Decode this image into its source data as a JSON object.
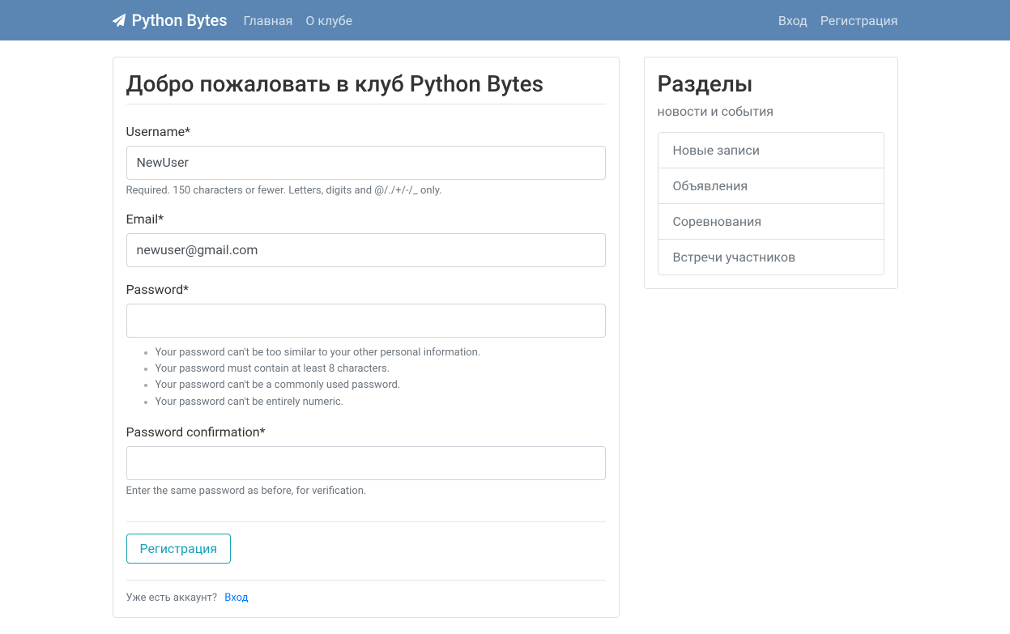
{
  "navbar": {
    "brand": "Python Bytes",
    "left_links": [
      "Главная",
      "О клубе"
    ],
    "right_links": [
      "Вход",
      "Регистрация"
    ]
  },
  "main": {
    "heading": "Добро пожаловать в клуб Python Bytes",
    "form": {
      "username": {
        "label": "Username*",
        "value": "NewUser",
        "help": "Required. 150 characters or fewer. Letters, digits and @/./+/-/_ only."
      },
      "email": {
        "label": "Email*",
        "value": "newuser@gmail.com"
      },
      "password1": {
        "label": "Password*",
        "help_items": [
          "Your password can't be too similar to your other personal information.",
          "Your password must contain at least 8 characters.",
          "Your password can't be a commonly used password.",
          "Your password can't be entirely numeric."
        ]
      },
      "password2": {
        "label": "Password confirmation*",
        "help": "Enter the same password as before, for verification."
      },
      "submit": "Регистрация"
    },
    "account_prompt": "Уже есть аккаунт?",
    "account_link": "Вход"
  },
  "sidebar": {
    "heading": "Разделы",
    "subtitle": "новости и события",
    "items": [
      "Новые записи",
      "Объявления",
      "Соревнования",
      "Встречи участников"
    ]
  }
}
